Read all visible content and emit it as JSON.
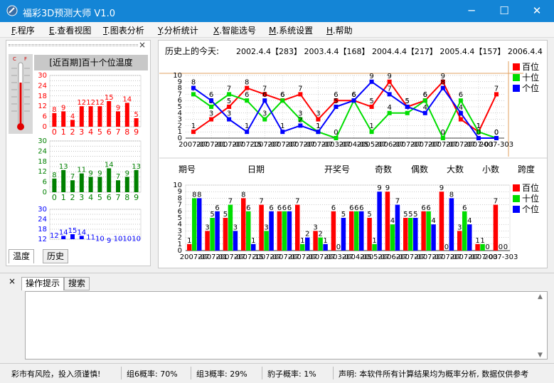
{
  "window": {
    "title": "福彩3D预测大师 V1.0",
    "minimize": "─",
    "maximize": "☐",
    "close": "✕"
  },
  "menu": [
    {
      "key": "F",
      "rest": ".程序"
    },
    {
      "key": "E",
      "rest": ".查看视图"
    },
    {
      "key": "T",
      "rest": ".图表分析"
    },
    {
      "key": "Y",
      "rest": ".分析统计"
    },
    {
      "key": "X",
      "rest": ".智能选号"
    },
    {
      "key": "M",
      "rest": ".系统设置"
    },
    {
      "key": "H",
      "rest": ".帮助"
    }
  ],
  "left_panel": {
    "close": "×",
    "title": "[近百期]百十个位温度",
    "thermo_labels": [
      "C",
      "F"
    ],
    "tabs": [
      "温度",
      "历史"
    ],
    "colors": {
      "bai": "#ff0000",
      "shi": "#008000",
      "ge": "#0000ff"
    }
  },
  "right_panel": {
    "history_label": "历史上的今天:",
    "history_text": "2002.4.4【283】 2003.4.4【168】 2004.4.4【217】 2005.4.4【157】 2006.4.4",
    "legend": [
      "百位",
      "十位",
      "个位"
    ],
    "columns": [
      "期号",
      "日期",
      "开奖号",
      "奇数",
      "偶数",
      "大数",
      "小数",
      "跨度"
    ],
    "xlabels": [
      "2007-07",
      "2007-01",
      "2007-07",
      "2007-15",
      "2007-07",
      "2007-07",
      "2007-07",
      "2007-07",
      "2003-07",
      "2004-05",
      "2005-07",
      "2006-07",
      "2007-07",
      "2007-07",
      "2007-07",
      "2007-07",
      "2007-03",
      "2007-303"
    ]
  },
  "chart_data": [
    {
      "type": "bar",
      "title": "[近百期]百十个位温度",
      "categories": [
        "0",
        "1",
        "2",
        "3",
        "4",
        "5",
        "6",
        "7",
        "8",
        "9"
      ],
      "series": [
        {
          "values": [
            8,
            9,
            4,
            12,
            12,
            12,
            15,
            9,
            14,
            5
          ]
        }
      ],
      "ylim": [
        0,
        30
      ],
      "yticks": [
        0,
        3,
        6,
        9,
        12,
        15,
        18,
        21,
        24,
        27,
        30
      ]
    },
    {
      "type": "bar",
      "categories": [
        "0",
        "1",
        "2",
        "3",
        "4",
        "5",
        "6",
        "7",
        "8",
        "9"
      ],
      "series": [
        {
          "values": [
            8,
            13,
            7,
            11,
            9,
            9,
            14,
            7,
            9,
            13
          ]
        }
      ],
      "ylim": [
        0,
        30
      ],
      "yticks": [
        0,
        3,
        6,
        9,
        12,
        15,
        18,
        21,
        24,
        27,
        30
      ]
    },
    {
      "type": "bar",
      "categories": [
        "0",
        "1",
        "2",
        "3",
        "4",
        "5",
        "6",
        "7",
        "8",
        "9"
      ],
      "series": [
        {
          "values": [
            12,
            14,
            15,
            14,
            11,
            10,
            9,
            10,
            10,
            10
          ]
        }
      ],
      "ylim": [
        0,
        30
      ],
      "yticks": [
        12,
        15,
        18,
        21,
        24,
        27,
        30
      ]
    },
    {
      "type": "line",
      "ylim": [
        0,
        10
      ],
      "yticks": [
        0,
        1,
        2,
        3,
        4,
        5,
        6,
        7,
        8,
        9,
        10
      ],
      "series": [
        {
          "name": "百位",
          "color": "#ff0000",
          "values": [
            1,
            3,
            5,
            8,
            7,
            6,
            7,
            3,
            6,
            6,
            5,
            9,
            5,
            6,
            9,
            3,
            1,
            7
          ]
        },
        {
          "name": "十位",
          "color": "#00dd00",
          "values": [
            7,
            5,
            7,
            6,
            3,
            6,
            3,
            1,
            0,
            6,
            1,
            4,
            4,
            6,
            0,
            6,
            1,
            0
          ]
        },
        {
          "name": "个位",
          "color": "#0000ff",
          "values": [
            8,
            6,
            3,
            1,
            6,
            1,
            2,
            1,
            5,
            6,
            9,
            7,
            5,
            4,
            8,
            4,
            0,
            0
          ]
        }
      ]
    },
    {
      "type": "bar",
      "ylim": [
        0,
        10
      ],
      "yticks": [
        0,
        1,
        2,
        3,
        4,
        5,
        6,
        7,
        8,
        9,
        10
      ],
      "series": [
        {
          "name": "百位",
          "color": "#ff0000",
          "values": [
            1,
            3,
            5,
            8,
            7,
            6,
            7,
            3,
            6,
            6,
            5,
            9,
            5,
            6,
            9,
            3,
            1,
            7
          ]
        },
        {
          "name": "十位",
          "color": "#00dd00",
          "values": [
            8,
            5,
            7,
            6,
            3,
            6,
            1,
            2,
            0,
            6,
            1,
            4,
            5,
            6,
            0,
            6,
            1,
            0
          ]
        },
        {
          "name": "个位",
          "color": "#0000ff",
          "values": [
            8,
            6,
            3,
            1,
            6,
            6,
            2,
            1,
            5,
            6,
            9,
            7,
            5,
            4,
            8,
            4,
            0,
            0
          ]
        }
      ]
    }
  ],
  "bottom_panel": {
    "close": "×",
    "tabs": [
      "操作提示",
      "搜索"
    ]
  },
  "status": [
    "彩市有风险，投入须谨慎!",
    "组6概率: 70%",
    "组3概率: 29%",
    "豹子概率: 1%",
    "声明: 本软件所有计算结果均为概率分析, 数据仅供参考"
  ]
}
